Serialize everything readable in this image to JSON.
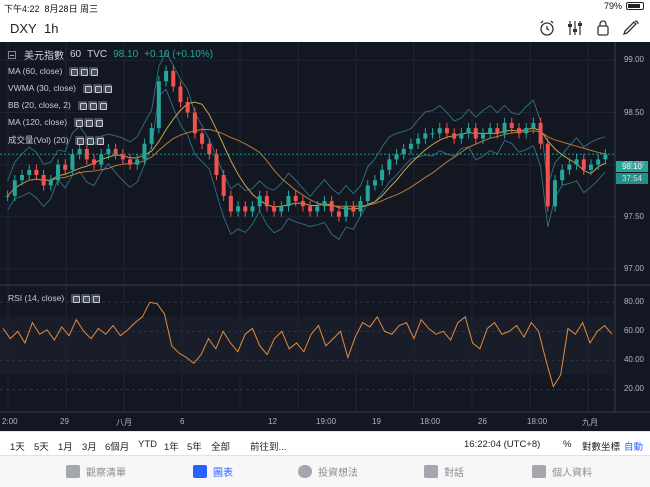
{
  "status_bar": {
    "time": "下午4:22",
    "date": "8月28日 周三",
    "battery": "79%"
  },
  "header": {
    "symbol": "DXY",
    "interval": "1h"
  },
  "chart": {
    "title": "美元指數",
    "resolution": "60",
    "source": "TVC",
    "last": "98.10",
    "change": "+0.10 (+0.10%)",
    "indicators": [
      {
        "label": "MA (60, close)"
      },
      {
        "label": "VWMA (30, close)"
      },
      {
        "label": "BB (20, close, 2)"
      },
      {
        "label": "MA (120, close)"
      },
      {
        "label": "成交量(Vol) (20)"
      }
    ],
    "rsi_label": "RSI (14, close)",
    "price_tag": "98.10",
    "countdown_tag": "37:54",
    "colors": {
      "up": "#26a69a",
      "down": "#ef5350",
      "bg": "#131722",
      "ma": "#e0a85a",
      "rsi": "#e58b3a",
      "tag": "#26a69a"
    }
  },
  "chart_data": {
    "type": "line",
    "series": [
      {
        "values": [
          97.7,
          97.85,
          97.9,
          97.95,
          97.9,
          97.8,
          97.85,
          98.0,
          97.95,
          98.1,
          98.15,
          98.05,
          98.0,
          98.1,
          98.15,
          98.1,
          98.05,
          98.0,
          98.05,
          98.2,
          98.35,
          98.8,
          98.9,
          98.75,
          98.6,
          98.5,
          98.3,
          98.2,
          98.1,
          97.9,
          97.7,
          97.55,
          97.6,
          97.55,
          97.6,
          97.7,
          97.6,
          97.55,
          97.6,
          97.7,
          97.65,
          97.6,
          97.55,
          97.6,
          97.65,
          97.55,
          97.5,
          97.6,
          97.55,
          97.65,
          97.8,
          97.85,
          97.95,
          98.05,
          98.1,
          98.15,
          98.2,
          98.25,
          98.3,
          98.3,
          98.35,
          98.3,
          98.25,
          98.3,
          98.35,
          98.25,
          98.3,
          98.35,
          98.3,
          98.4,
          98.35,
          98.3,
          98.35,
          98.4,
          98.2,
          97.6,
          97.85,
          97.95,
          98.0,
          98.05,
          97.95,
          98.0,
          98.05,
          98.1
        ]
      }
    ],
    "ylim": [
      96.95,
      99.1
    ],
    "y_ticks": [
      "99.00",
      "98.50",
      "98.00",
      "97.50",
      "97.00"
    ],
    "x_ticks": [
      "2:00",
      "29",
      "八月",
      "6",
      "12",
      "19:00",
      "19",
      "18:00",
      "26",
      "18:00",
      "九月"
    ],
    "rsi": {
      "values": [
        62,
        55,
        60,
        52,
        66,
        58,
        61,
        54,
        63,
        57,
        68,
        60,
        55,
        62,
        58,
        64,
        57,
        61,
        66,
        70,
        80,
        79,
        72,
        50,
        45,
        42,
        38,
        44,
        55,
        48,
        60,
        52,
        46,
        58,
        62,
        50,
        44,
        55,
        60,
        48,
        52,
        46,
        58,
        64,
        50,
        55,
        60,
        42,
        56,
        66,
        63,
        70,
        60,
        58,
        64,
        66,
        55,
        68,
        62,
        58,
        60,
        54,
        66,
        70,
        52,
        48,
        62,
        66,
        58,
        60,
        64,
        56,
        66,
        60,
        40,
        22,
        30,
        62,
        58,
        66,
        52,
        60,
        64,
        58
      ],
      "ylim": [
        10,
        85
      ],
      "y_ticks": [
        "80.00",
        "60.00",
        "40.00",
        "20.00"
      ]
    }
  },
  "range_bar": {
    "ranges": [
      "1天",
      "5天",
      "1月",
      "3月",
      "6個月",
      "YTD",
      "1年",
      "5年",
      "全部"
    ],
    "goto": "前往到...",
    "clock": "16:22:04 (UTC+8)",
    "percent": "%",
    "log": "對數坐標",
    "auto": "自動"
  },
  "tabs": [
    {
      "label": "觀察清單",
      "icon": "watchlist-icon"
    },
    {
      "label": "圖表",
      "icon": "chart-icon"
    },
    {
      "label": "投資想法",
      "icon": "ideas-icon"
    },
    {
      "label": "對話",
      "icon": "chat-icon"
    },
    {
      "label": "個人資料",
      "icon": "profile-icon"
    }
  ]
}
